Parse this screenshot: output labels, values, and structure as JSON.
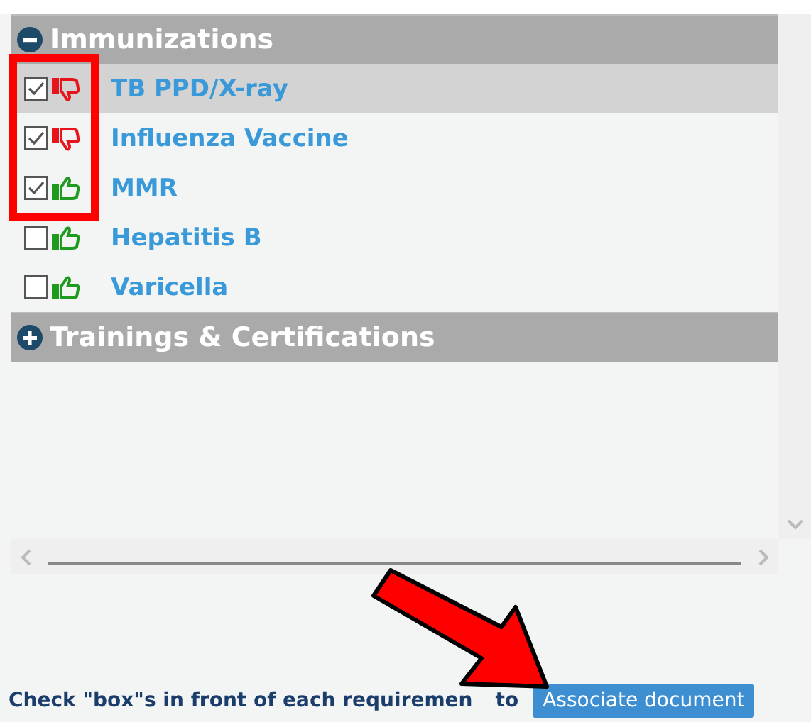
{
  "sections": [
    {
      "title": "Immunizations",
      "expanded": true,
      "items": [
        {
          "label": "TB PPD/X-ray",
          "checked": true,
          "kind": "down",
          "selected": true
        },
        {
          "label": "Influenza Vaccine",
          "checked": true,
          "kind": "down",
          "selected": false
        },
        {
          "label": "MMR",
          "checked": true,
          "kind": "up",
          "selected": false
        },
        {
          "label": "Hepatitis B",
          "checked": false,
          "kind": "up",
          "selected": false
        },
        {
          "label": "Varicella",
          "checked": false,
          "kind": "up",
          "selected": false
        }
      ]
    },
    {
      "title": "Trainings & Certifications",
      "expanded": false
    }
  ],
  "footer": {
    "instruction": "Check \"box\"s in front of each requiremen",
    "instruction_tail": "to",
    "button": "Associate document"
  }
}
